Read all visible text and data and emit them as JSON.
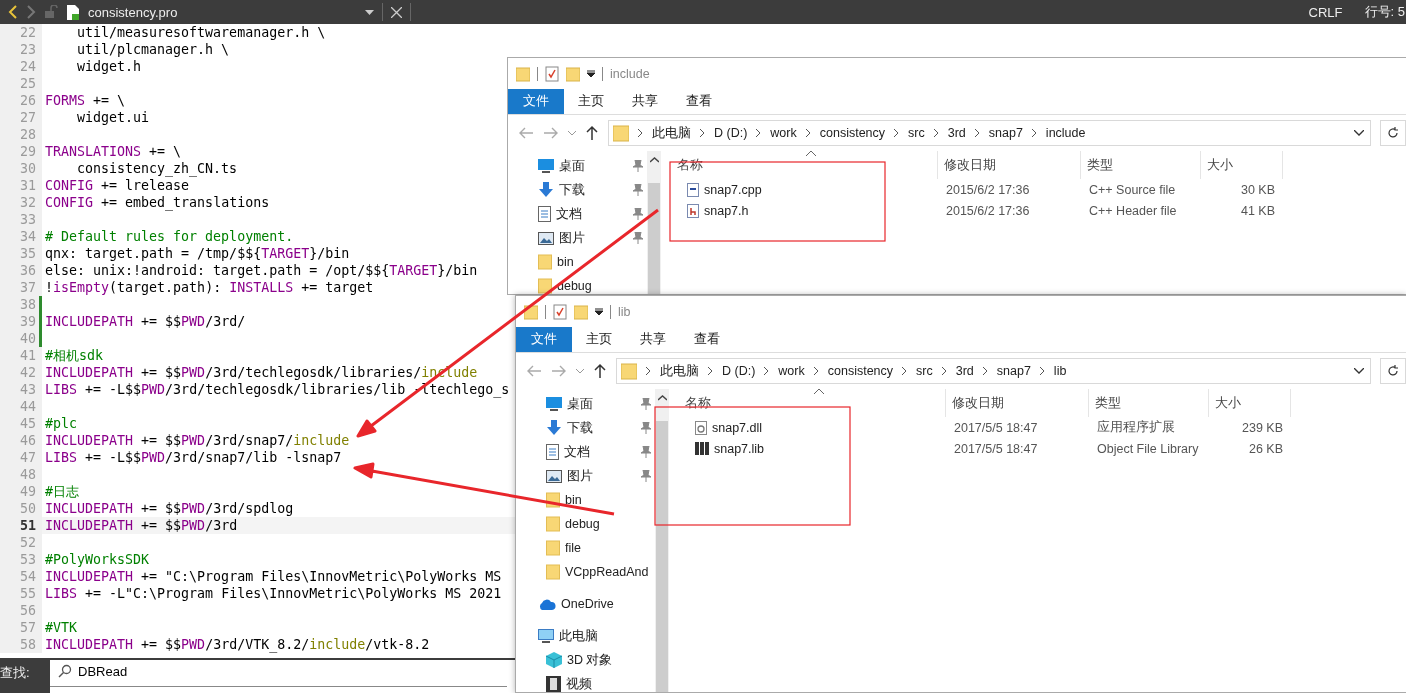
{
  "editor": {
    "tab_title": "consistency.pro",
    "line_ending": "CRLF",
    "line_status": "行号: 5",
    "lines": [
      {
        "number": "22",
        "current": false,
        "modified": false,
        "segments": [
          {
            "text": "    util/measuresoftwaremanager.h \\",
            "kind": "plain"
          }
        ]
      },
      {
        "number": "23",
        "current": false,
        "modified": false,
        "segments": [
          {
            "text": "    util/plcmanager.h \\",
            "kind": "plain"
          }
        ]
      },
      {
        "number": "24",
        "current": false,
        "modified": false,
        "segments": [
          {
            "text": "    widget.h",
            "kind": "plain"
          }
        ]
      },
      {
        "number": "25",
        "current": false,
        "modified": false
      },
      {
        "number": "26",
        "current": false,
        "modified": false,
        "segments": [
          {
            "text": "FORMS",
            "kind": "keyword"
          },
          {
            "text": " += \\",
            "kind": "plain"
          }
        ]
      },
      {
        "number": "27",
        "current": false,
        "modified": false,
        "segments": [
          {
            "text": "    widget.ui",
            "kind": "plain"
          }
        ]
      },
      {
        "number": "28",
        "current": false,
        "modified": false
      },
      {
        "number": "29",
        "current": false,
        "modified": false,
        "segments": [
          {
            "text": "TRANSLATIONS",
            "kind": "keyword"
          },
          {
            "text": " += \\",
            "kind": "plain"
          }
        ]
      },
      {
        "number": "30",
        "current": false,
        "modified": false,
        "segments": [
          {
            "text": "    consistency_zh_CN.ts",
            "kind": "plain"
          }
        ]
      },
      {
        "number": "31",
        "current": false,
        "modified": false,
        "segments": [
          {
            "text": "CONFIG",
            "kind": "keyword"
          },
          {
            "text": " += lrelease",
            "kind": "plain"
          }
        ]
      },
      {
        "number": "32",
        "current": false,
        "modified": false,
        "segments": [
          {
            "text": "CONFIG",
            "kind": "keyword"
          },
          {
            "text": " += embed_translations",
            "kind": "plain"
          }
        ]
      },
      {
        "number": "33",
        "current": false,
        "modified": false
      },
      {
        "number": "34",
        "current": false,
        "modified": false,
        "segments": [
          {
            "text": "# Default rules for deployment.",
            "kind": "comment"
          }
        ]
      },
      {
        "number": "35",
        "current": false,
        "modified": false,
        "segments": [
          {
            "text": "qnx: target.path = /tmp/$${",
            "kind": "plain"
          },
          {
            "text": "TARGET",
            "kind": "variable"
          },
          {
            "text": "}/bin",
            "kind": "plain"
          }
        ]
      },
      {
        "number": "36",
        "current": false,
        "modified": false,
        "segments": [
          {
            "text": "else: unix:!android: target.path = /opt/$${",
            "kind": "plain"
          },
          {
            "text": "TARGET",
            "kind": "variable"
          },
          {
            "text": "}/bin",
            "kind": "plain"
          }
        ]
      },
      {
        "number": "37",
        "current": false,
        "modified": false,
        "segments": [
          {
            "text": "!",
            "kind": "plain"
          },
          {
            "text": "isEmpty",
            "kind": "variable"
          },
          {
            "text": "(target.path): ",
            "kind": "plain"
          },
          {
            "text": "INSTALLS",
            "kind": "keyword"
          },
          {
            "text": " += target",
            "kind": "plain"
          }
        ]
      },
      {
        "number": "38",
        "current": false,
        "modified": true
      },
      {
        "number": "39",
        "current": false,
        "modified": true,
        "segments": [
          {
            "text": "INCLUDEPATH",
            "kind": "keyword"
          },
          {
            "text": " += $$",
            "kind": "plain"
          },
          {
            "text": "PWD",
            "kind": "variable"
          },
          {
            "text": "/3rd/",
            "kind": "plain"
          }
        ]
      },
      {
        "number": "40",
        "current": false,
        "modified": true
      },
      {
        "number": "41",
        "current": false,
        "modified": false,
        "segments": [
          {
            "text": "#相机sdk",
            "kind": "comment"
          }
        ]
      },
      {
        "number": "42",
        "current": false,
        "modified": false,
        "segments": [
          {
            "text": "INCLUDEPATH",
            "kind": "keyword"
          },
          {
            "text": " += $$",
            "kind": "plain"
          },
          {
            "text": "PWD",
            "kind": "variable"
          },
          {
            "text": "/3rd/techlegosdk/libraries/",
            "kind": "plain"
          },
          {
            "text": "include",
            "kind": "builtin"
          }
        ]
      },
      {
        "number": "43",
        "current": false,
        "modified": false,
        "segments": [
          {
            "text": "LIBS",
            "kind": "keyword"
          },
          {
            "text": " += -L$$",
            "kind": "plain"
          },
          {
            "text": "PWD",
            "kind": "variable"
          },
          {
            "text": "/3rd/techlegosdk/libraries/lib -ltechlego_s",
            "kind": "plain"
          }
        ]
      },
      {
        "number": "44",
        "current": false,
        "modified": false
      },
      {
        "number": "45",
        "current": false,
        "modified": false,
        "segments": [
          {
            "text": "#plc",
            "kind": "comment"
          }
        ]
      },
      {
        "number": "46",
        "current": false,
        "modified": false,
        "segments": [
          {
            "text": "INCLUDEPATH",
            "kind": "keyword"
          },
          {
            "text": " += $$",
            "kind": "plain"
          },
          {
            "text": "PWD",
            "kind": "variable"
          },
          {
            "text": "/3rd/snap7/",
            "kind": "plain"
          },
          {
            "text": "include",
            "kind": "builtin"
          }
        ]
      },
      {
        "number": "47",
        "current": false,
        "modified": false,
        "segments": [
          {
            "text": "LIBS",
            "kind": "keyword"
          },
          {
            "text": " += -L$$",
            "kind": "plain"
          },
          {
            "text": "PWD",
            "kind": "variable"
          },
          {
            "text": "/3rd/snap7/lib -lsnap7",
            "kind": "plain"
          }
        ]
      },
      {
        "number": "48",
        "current": false,
        "modified": false
      },
      {
        "number": "49",
        "current": false,
        "modified": false,
        "segments": [
          {
            "text": "#日志",
            "kind": "comment"
          }
        ]
      },
      {
        "number": "50",
        "current": false,
        "modified": false,
        "segments": [
          {
            "text": "INCLUDEPATH",
            "kind": "keyword"
          },
          {
            "text": " += $$",
            "kind": "plain"
          },
          {
            "text": "PWD",
            "kind": "variable"
          },
          {
            "text": "/3rd/spdlog",
            "kind": "plain"
          }
        ]
      },
      {
        "number": "51",
        "current": true,
        "modified": false,
        "segments": [
          {
            "text": "INCLUDEPATH",
            "kind": "keyword"
          },
          {
            "text": " += $$",
            "kind": "plain"
          },
          {
            "text": "PWD",
            "kind": "variable"
          },
          {
            "text": "/3rd",
            "kind": "plain"
          }
        ]
      },
      {
        "number": "52",
        "current": false,
        "modified": false
      },
      {
        "number": "53",
        "current": false,
        "modified": false,
        "segments": [
          {
            "text": "#PolyWorksSDK",
            "kind": "comment"
          }
        ]
      },
      {
        "number": "54",
        "current": false,
        "modified": false,
        "segments": [
          {
            "text": "INCLUDEPATH",
            "kind": "keyword"
          },
          {
            "text": " += \"C:\\Program Files\\InnovMetric\\PolyWorks MS",
            "kind": "plain"
          }
        ]
      },
      {
        "number": "55",
        "current": false,
        "modified": false,
        "segments": [
          {
            "text": "LIBS",
            "kind": "keyword"
          },
          {
            "text": " += -L\"C:\\Program Files\\InnovMetric\\PolyWorks MS 2021",
            "kind": "plain"
          }
        ]
      },
      {
        "number": "56",
        "current": false,
        "modified": false
      },
      {
        "number": "57",
        "current": false,
        "modified": false,
        "segments": [
          {
            "text": "#VTK",
            "kind": "comment"
          }
        ]
      },
      {
        "number": "58",
        "current": false,
        "modified": false,
        "segments": [
          {
            "text": "INCLUDEPATH",
            "kind": "keyword"
          },
          {
            "text": " += $$",
            "kind": "plain"
          },
          {
            "text": "PWD",
            "kind": "variable"
          },
          {
            "text": "/3rd/VTK_8.2/",
            "kind": "plain"
          },
          {
            "text": "include",
            "kind": "builtin"
          },
          {
            "text": "/vtk-8.2",
            "kind": "plain"
          }
        ]
      }
    ],
    "find": {
      "label": "查找:",
      "value": "DBRead"
    }
  },
  "explorers": [
    {
      "title": "include",
      "ribbon_tabs": [
        {
          "label": "文件",
          "selected": true
        },
        {
          "label": "主页",
          "selected": false
        },
        {
          "label": "共享",
          "selected": false
        },
        {
          "label": "查看",
          "selected": false
        }
      ],
      "breadcrumb": [
        "此电脑",
        "D (D:)",
        "work",
        "consistency",
        "src",
        "3rd",
        "snap7",
        "include"
      ],
      "nav_items": [
        {
          "label": "桌面",
          "kind": "desktop",
          "pinned": true
        },
        {
          "label": "下载",
          "kind": "download",
          "pinned": true
        },
        {
          "label": "文档",
          "kind": "document",
          "pinned": true
        },
        {
          "label": "图片",
          "kind": "picture",
          "pinned": true
        },
        {
          "label": "bin",
          "kind": "folder",
          "pinned": false
        },
        {
          "label": "debug",
          "kind": "folder",
          "pinned": false
        }
      ],
      "columns": [
        "名称",
        "修改日期",
        "类型",
        "大小"
      ],
      "files": [
        {
          "name": "snap7.cpp",
          "kind": "cpp",
          "modified": "2015/6/2 17:36",
          "type": "C++ Source file",
          "size": "30 KB"
        },
        {
          "name": "snap7.h",
          "kind": "header",
          "modified": "2015/6/2 17:36",
          "type": "C++ Header file",
          "size": "41 KB"
        }
      ]
    },
    {
      "title": "lib",
      "ribbon_tabs": [
        {
          "label": "文件",
          "selected": true
        },
        {
          "label": "主页",
          "selected": false
        },
        {
          "label": "共享",
          "selected": false
        },
        {
          "label": "查看",
          "selected": false
        }
      ],
      "breadcrumb": [
        "此电脑",
        "D (D:)",
        "work",
        "consistency",
        "src",
        "3rd",
        "snap7",
        "lib"
      ],
      "nav_items": [
        {
          "label": "桌面",
          "kind": "desktop",
          "pinned": true
        },
        {
          "label": "下载",
          "kind": "download",
          "pinned": true
        },
        {
          "label": "文档",
          "kind": "document",
          "pinned": true
        },
        {
          "label": "图片",
          "kind": "picture",
          "pinned": true
        },
        {
          "label": "bin",
          "kind": "folder",
          "pinned": false
        },
        {
          "label": "debug",
          "kind": "folder",
          "pinned": false
        },
        {
          "label": "file",
          "kind": "folder",
          "pinned": false
        },
        {
          "label": "VCppReadAnd",
          "kind": "folder",
          "pinned": false
        },
        {
          "label": "OneDrive",
          "kind": "cloud",
          "pinned": false
        },
        {
          "label": "此电脑",
          "kind": "computer",
          "pinned": false
        },
        {
          "label": "3D 对象",
          "kind": "cube",
          "pinned": false
        },
        {
          "label": "视频",
          "kind": "video",
          "pinned": false
        }
      ],
      "columns": [
        "名称",
        "修改日期",
        "类型",
        "大小"
      ],
      "files": [
        {
          "name": "snap7.dll",
          "kind": "dll",
          "modified": "2017/5/5 18:47",
          "type": "应用程序扩展",
          "size": "239 KB"
        },
        {
          "name": "snap7.lib",
          "kind": "lib",
          "modified": "2017/5/5 18:47",
          "type": "Object File Library",
          "size": "26 KB"
        }
      ]
    }
  ]
}
